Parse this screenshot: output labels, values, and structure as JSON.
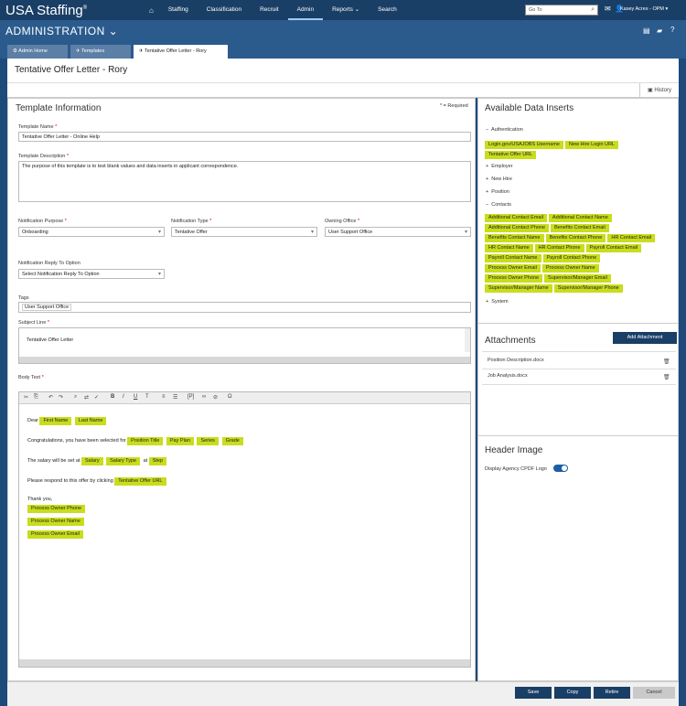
{
  "app": {
    "logo": "USA Staffing",
    "logo_mark": "®"
  },
  "nav": {
    "items": [
      "Staffing",
      "Classification",
      "Recruit",
      "Admin",
      "Reports",
      "Search"
    ],
    "reports_caret": "⌄"
  },
  "goto": {
    "placeholder": "Go To"
  },
  "user": {
    "name": "Kasey Acres - OPM"
  },
  "admin": {
    "title": "ADMINISTRATION"
  },
  "tabs": [
    "Admin Home",
    "Templates",
    "Tentative Offer Letter - Rory"
  ],
  "page": {
    "title": "Tentative Offer Letter - Rory",
    "history": "History"
  },
  "form": {
    "heading": "Template Information",
    "required_note": "* = Required",
    "template_name": {
      "label": "Template Name",
      "value": "Tentative Offer Letter - Online Help"
    },
    "template_description": {
      "label": "Template Description",
      "value": "The purpose of this template is to test blank values and data inserts in applicant correspondence."
    },
    "notification_purpose": {
      "label": "Notification Purpose",
      "value": "Onboarding"
    },
    "notification_type": {
      "label": "Notification Type",
      "value": "Tentative Offer"
    },
    "owning_office": {
      "label": "Owning Office",
      "value": "User Support Office"
    },
    "reply_to": {
      "label": "Notification Reply To Option",
      "value": "Select Notification Reply To Option"
    },
    "tags": {
      "label": "Tags",
      "value": "User Support Office"
    },
    "subject_line": {
      "label": "Subject Line",
      "value": "Tentative Offer Letter"
    },
    "body_text": {
      "label": "Body Text"
    }
  },
  "body": {
    "dear": "Dear",
    "first_name": "First Name",
    "last_name": "Last Name",
    "congrats": "Congratulations, you have been selected for",
    "position_title": "Position Title",
    "pay_plan": "Pay Plan",
    "series": "Series",
    "grade": "Grade",
    "salary_text": "The salary will be set at",
    "salary": "Salary",
    "salary_type": "Salary Type",
    "at": "at",
    "step": "Step",
    "respond": "Please respond to this offer by clicking",
    "offer_url": "Tentative Offer URL",
    "thank_you": "Thank you,",
    "owner_phone": "Process Owner Phone",
    "owner_name": "Process Owner Name",
    "owner_email": "Process Owner Email"
  },
  "inserts": {
    "heading": "Available Data Inserts",
    "authentication": {
      "label": "Authentication",
      "chips": [
        "Login.gov/USAJOBS Username",
        "New Hire Login URL",
        "Tentative Offer URL"
      ]
    },
    "employer": "Employer",
    "new_hire": "New Hire",
    "position": "Position",
    "contacts": {
      "label": "Contacts",
      "chips": [
        "Additional Contact Email",
        "Additional Contact Name",
        "Additional Contact Phone",
        "Benefits Contact Email",
        "Benefits Contact Name",
        "Benefits Contact Phone",
        "HR Contact Email",
        "HR Contact Name",
        "HR Contact Phone",
        "Payroll Contact Email",
        "Payroll Contact Name",
        "Payroll Contact Phone",
        "Process Owner Email",
        "Process Owner Name",
        "Process Owner Phone",
        "Supervisor/Manager Email",
        "Supervisor/Manager Name",
        "Supervisor/Manager Phone"
      ]
    },
    "system": "System",
    "plus": "+",
    "minus": "−"
  },
  "attachments": {
    "heading": "Attachments",
    "add": "Add Attachment",
    "files": [
      "Position Description.docx",
      "Job Analysis.docx"
    ]
  },
  "header_image": {
    "heading": "Header Image",
    "toggle_label": "Display Agency CPDF Logo"
  },
  "footer": {
    "save": "Save",
    "copy": "Copy",
    "retire": "Retire",
    "cancel": "Cancel"
  }
}
